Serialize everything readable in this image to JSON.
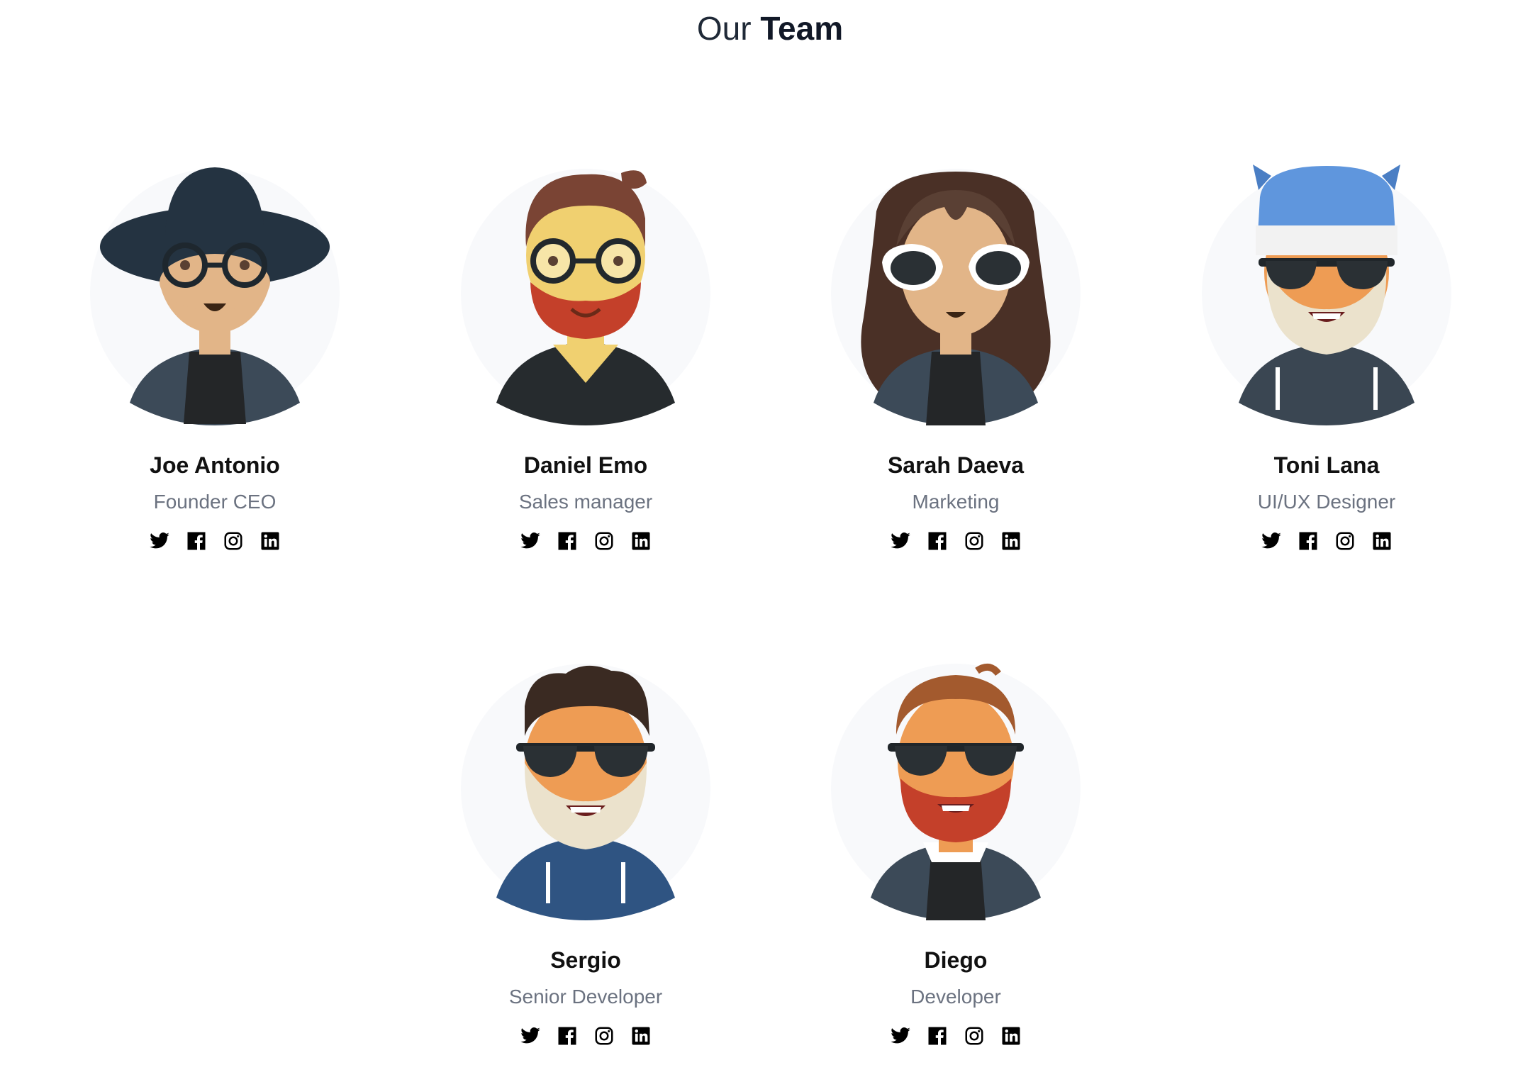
{
  "heading": {
    "prefix": "Our",
    "emphasis": "Team"
  },
  "members": [
    {
      "name": "Joe Antonio",
      "role": "Founder CEO",
      "avatar": "hat-glasses"
    },
    {
      "name": "Daniel Emo",
      "role": "Sales manager",
      "avatar": "red-beard-glasses"
    },
    {
      "name": "Sarah Daeva",
      "role": "Marketing",
      "avatar": "long-hair-sunglasses"
    },
    {
      "name": "Toni Lana",
      "role": "UI/UX Designer",
      "avatar": "beanie-beard"
    },
    {
      "name": "Sergio",
      "role": "Senior Developer",
      "avatar": "curly-beard-hoodie"
    },
    {
      "name": "Diego",
      "role": "Developer",
      "avatar": "ginger-beard-blazer"
    }
  ],
  "social_icons": [
    "twitter-icon",
    "facebook-icon",
    "instagram-icon",
    "linkedin-icon"
  ],
  "colors": {
    "circle": "#f8f9fb",
    "role_text": "#6b7280",
    "name_text": "#111111"
  }
}
